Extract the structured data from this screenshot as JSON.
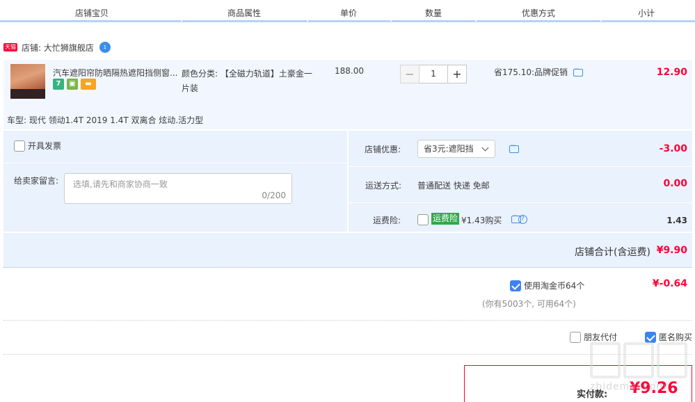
{
  "header": {
    "columns": [
      "店铺宝贝",
      "商品属性",
      "单价",
      "数量",
      "优惠方式",
      "小计"
    ]
  },
  "shop": {
    "badge": "天猫",
    "name": "店铺: 大忙狮旗舰店",
    "ww_badge": "1"
  },
  "item": {
    "title": "汽车遮阳帘防晒隔热遮阳挡侧窗...",
    "property": "颜色分类: 【全磁力轨道】土豪金一片装",
    "price": "188.00",
    "quantity": "1",
    "minus": "−",
    "plus": "+",
    "promo": "省175.10:品牌促销",
    "subtotal": "12.90",
    "car_model": "车型: 现代 领动1.4T 2019 1.4T 双离合 炫动.活力型",
    "icon7": "7"
  },
  "invoice": {
    "label": "开具发票"
  },
  "message": {
    "label": "给卖家留言:",
    "placeholder": "选填,请先和商家协商一致",
    "counter": "0/200"
  },
  "shop_discount": {
    "label": "店铺优惠:",
    "selected": "省3元:遮阳挡",
    "amount": "-3.00"
  },
  "shipping": {
    "label": "运送方式:",
    "value": "普通配送 快递 免邮",
    "amount": "0.00"
  },
  "insurance": {
    "label": "运费险:",
    "badge": "运费险",
    "price": "¥1.43购买",
    "help": "?",
    "amount": "1.43"
  },
  "shop_total": {
    "label": "店铺合计(含运费)",
    "amount": "¥9.90"
  },
  "coins": {
    "label": "使用淘金币64个",
    "sub": "(你有5003个, 可用64个)",
    "amount": "¥-0.64"
  },
  "options": {
    "friend_pay": "朋友代付",
    "anonymous": "匿名购买"
  },
  "payment": {
    "label": "实付款:",
    "amount": "¥9.26"
  },
  "watermark": {
    "text": "zhidemai.com"
  },
  "colors": {
    "accent_red": "#ff0036",
    "panel_blue": "#eaf2fe",
    "checkbox_blue": "#3c82f5",
    "tmall_red": "#ff0036"
  }
}
